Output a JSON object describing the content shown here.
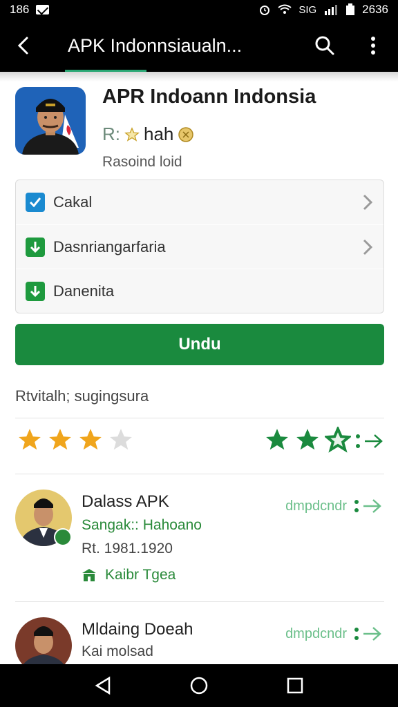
{
  "status_bar": {
    "time": "186",
    "right_text": "2636",
    "signal_text": "SIG"
  },
  "app_bar": {
    "title": "APK Indonnsiaualn..."
  },
  "app": {
    "name": "APR Indoann Indonsia",
    "rating_prefix": "R:",
    "rating_text": "hah",
    "subtitle": "Rasoind loid"
  },
  "options": [
    {
      "label": "Cakal",
      "icon": "checkbox-icon",
      "color": "#1a8ad0",
      "chevron": true
    },
    {
      "label": "Dasnriangarfaria",
      "icon": "download-icon",
      "color": "#1e9a3e",
      "chevron": true
    },
    {
      "label": "Danenita",
      "icon": "download-icon",
      "color": "#1e9a3e",
      "chevron": false
    }
  ],
  "download_button": {
    "label": "Undu"
  },
  "section": {
    "label": "Rtvitalh; sugingsura"
  },
  "ratings": {
    "left_stars_filled": 3,
    "left_stars_total": 4,
    "right_stars": 3
  },
  "list": [
    {
      "title": "Dalass APK",
      "subtitle": "Sangak:: Hahoano",
      "meta": "Rt. 1981.1920",
      "tag": "Kaibr Tgea",
      "action_text": "dmpdcndr"
    },
    {
      "title": "Mldaing Doeah",
      "meta": "Kai molsad",
      "action_text": "dmpdcndr"
    }
  ],
  "colors": {
    "accent": "#1a8a3e",
    "star_gold": "#f0a51c",
    "star_green": "#1a8a3e"
  }
}
